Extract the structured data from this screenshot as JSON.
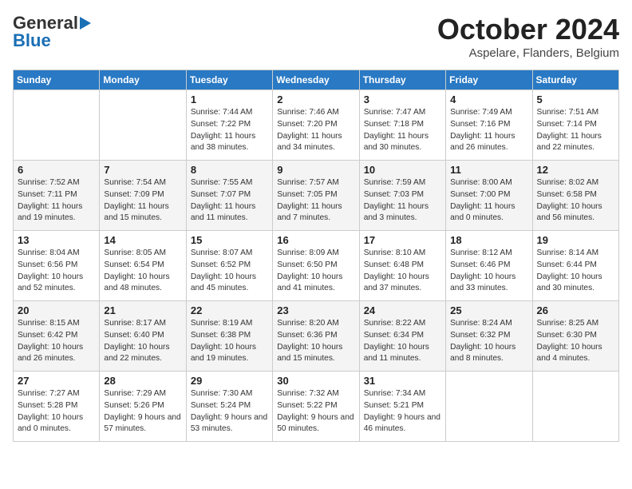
{
  "header": {
    "logo_line1": "General",
    "logo_line2": "Blue",
    "month": "October 2024",
    "location": "Aspelare, Flanders, Belgium"
  },
  "days_of_week": [
    "Sunday",
    "Monday",
    "Tuesday",
    "Wednesday",
    "Thursday",
    "Friday",
    "Saturday"
  ],
  "weeks": [
    [
      {
        "day": "",
        "info": ""
      },
      {
        "day": "",
        "info": ""
      },
      {
        "day": "1",
        "info": "Sunrise: 7:44 AM\nSunset: 7:22 PM\nDaylight: 11 hours and 38 minutes."
      },
      {
        "day": "2",
        "info": "Sunrise: 7:46 AM\nSunset: 7:20 PM\nDaylight: 11 hours and 34 minutes."
      },
      {
        "day": "3",
        "info": "Sunrise: 7:47 AM\nSunset: 7:18 PM\nDaylight: 11 hours and 30 minutes."
      },
      {
        "day": "4",
        "info": "Sunrise: 7:49 AM\nSunset: 7:16 PM\nDaylight: 11 hours and 26 minutes."
      },
      {
        "day": "5",
        "info": "Sunrise: 7:51 AM\nSunset: 7:14 PM\nDaylight: 11 hours and 22 minutes."
      }
    ],
    [
      {
        "day": "6",
        "info": "Sunrise: 7:52 AM\nSunset: 7:11 PM\nDaylight: 11 hours and 19 minutes."
      },
      {
        "day": "7",
        "info": "Sunrise: 7:54 AM\nSunset: 7:09 PM\nDaylight: 11 hours and 15 minutes."
      },
      {
        "day": "8",
        "info": "Sunrise: 7:55 AM\nSunset: 7:07 PM\nDaylight: 11 hours and 11 minutes."
      },
      {
        "day": "9",
        "info": "Sunrise: 7:57 AM\nSunset: 7:05 PM\nDaylight: 11 hours and 7 minutes."
      },
      {
        "day": "10",
        "info": "Sunrise: 7:59 AM\nSunset: 7:03 PM\nDaylight: 11 hours and 3 minutes."
      },
      {
        "day": "11",
        "info": "Sunrise: 8:00 AM\nSunset: 7:00 PM\nDaylight: 11 hours and 0 minutes."
      },
      {
        "day": "12",
        "info": "Sunrise: 8:02 AM\nSunset: 6:58 PM\nDaylight: 10 hours and 56 minutes."
      }
    ],
    [
      {
        "day": "13",
        "info": "Sunrise: 8:04 AM\nSunset: 6:56 PM\nDaylight: 10 hours and 52 minutes."
      },
      {
        "day": "14",
        "info": "Sunrise: 8:05 AM\nSunset: 6:54 PM\nDaylight: 10 hours and 48 minutes."
      },
      {
        "day": "15",
        "info": "Sunrise: 8:07 AM\nSunset: 6:52 PM\nDaylight: 10 hours and 45 minutes."
      },
      {
        "day": "16",
        "info": "Sunrise: 8:09 AM\nSunset: 6:50 PM\nDaylight: 10 hours and 41 minutes."
      },
      {
        "day": "17",
        "info": "Sunrise: 8:10 AM\nSunset: 6:48 PM\nDaylight: 10 hours and 37 minutes."
      },
      {
        "day": "18",
        "info": "Sunrise: 8:12 AM\nSunset: 6:46 PM\nDaylight: 10 hours and 33 minutes."
      },
      {
        "day": "19",
        "info": "Sunrise: 8:14 AM\nSunset: 6:44 PM\nDaylight: 10 hours and 30 minutes."
      }
    ],
    [
      {
        "day": "20",
        "info": "Sunrise: 8:15 AM\nSunset: 6:42 PM\nDaylight: 10 hours and 26 minutes."
      },
      {
        "day": "21",
        "info": "Sunrise: 8:17 AM\nSunset: 6:40 PM\nDaylight: 10 hours and 22 minutes."
      },
      {
        "day": "22",
        "info": "Sunrise: 8:19 AM\nSunset: 6:38 PM\nDaylight: 10 hours and 19 minutes."
      },
      {
        "day": "23",
        "info": "Sunrise: 8:20 AM\nSunset: 6:36 PM\nDaylight: 10 hours and 15 minutes."
      },
      {
        "day": "24",
        "info": "Sunrise: 8:22 AM\nSunset: 6:34 PM\nDaylight: 10 hours and 11 minutes."
      },
      {
        "day": "25",
        "info": "Sunrise: 8:24 AM\nSunset: 6:32 PM\nDaylight: 10 hours and 8 minutes."
      },
      {
        "day": "26",
        "info": "Sunrise: 8:25 AM\nSunset: 6:30 PM\nDaylight: 10 hours and 4 minutes."
      }
    ],
    [
      {
        "day": "27",
        "info": "Sunrise: 7:27 AM\nSunset: 5:28 PM\nDaylight: 10 hours and 0 minutes."
      },
      {
        "day": "28",
        "info": "Sunrise: 7:29 AM\nSunset: 5:26 PM\nDaylight: 9 hours and 57 minutes."
      },
      {
        "day": "29",
        "info": "Sunrise: 7:30 AM\nSunset: 5:24 PM\nDaylight: 9 hours and 53 minutes."
      },
      {
        "day": "30",
        "info": "Sunrise: 7:32 AM\nSunset: 5:22 PM\nDaylight: 9 hours and 50 minutes."
      },
      {
        "day": "31",
        "info": "Sunrise: 7:34 AM\nSunset: 5:21 PM\nDaylight: 9 hours and 46 minutes."
      },
      {
        "day": "",
        "info": ""
      },
      {
        "day": "",
        "info": ""
      }
    ]
  ]
}
